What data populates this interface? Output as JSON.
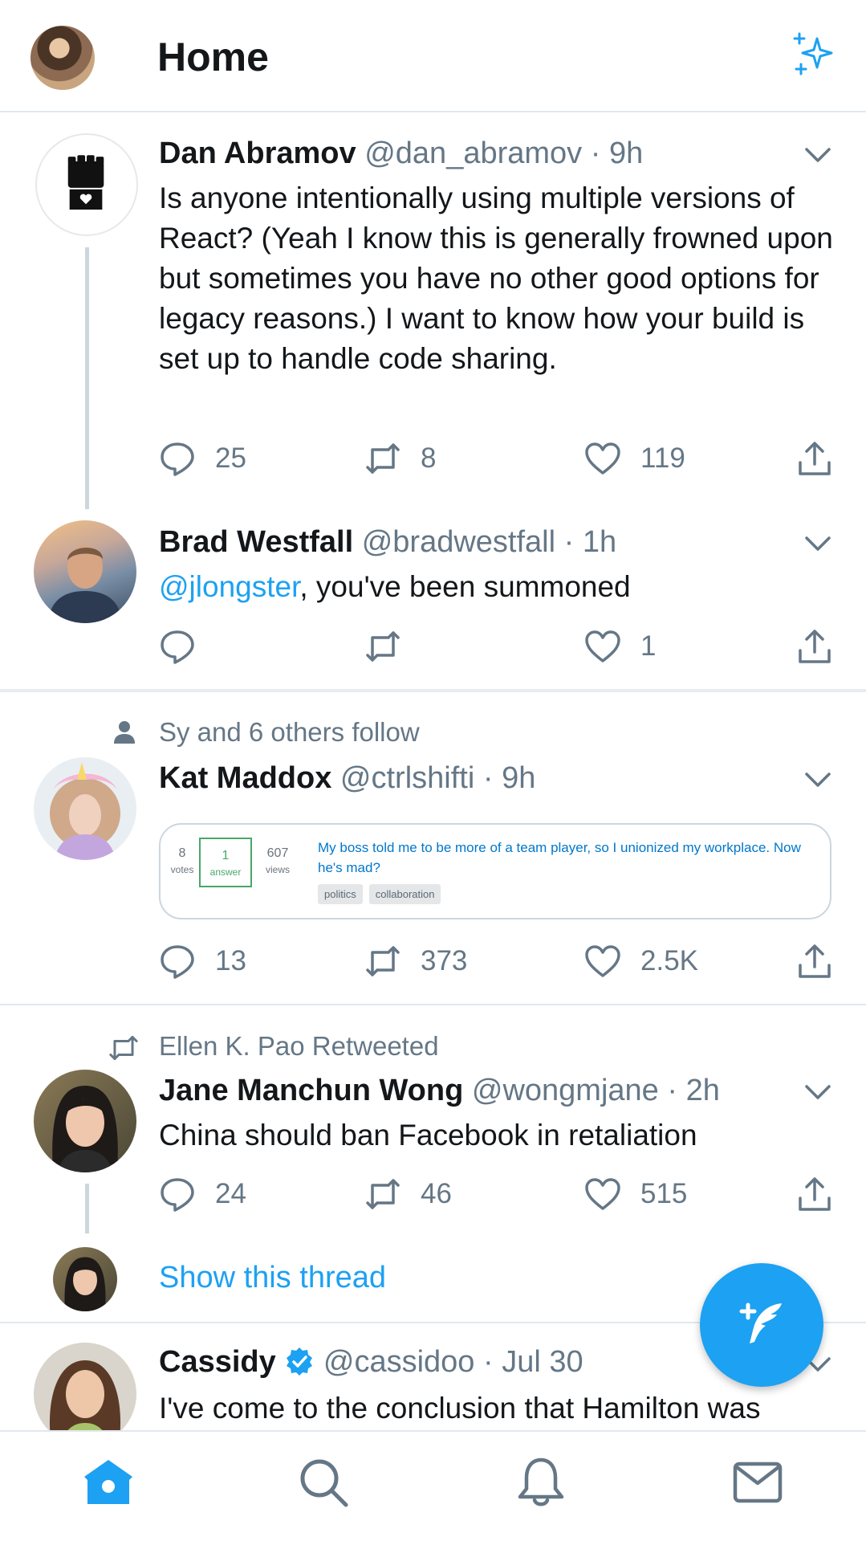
{
  "header": {
    "title": "Home",
    "sparkle_icon": "sparkle-icon",
    "accent": "#1da1f2"
  },
  "tweets": [
    {
      "name": "Dan Abramov",
      "handle": "@dan_abramov",
      "time": "9h",
      "text": "Is anyone intentionally using multiple versions of React? (Yeah I know this is generally frowned upon but sometimes you have no other good options for legacy reasons.) I want to know how your build is set up to handle code sharing.",
      "replies": "25",
      "retweets": "8",
      "likes": "119"
    },
    {
      "name": "Brad Westfall",
      "handle": "@bradwestfall",
      "time": "1h",
      "mention": "@jlongster",
      "text_rest": ", you've been summoned",
      "replies": "",
      "retweets": "",
      "likes": "1"
    },
    {
      "context": "Sy and 6 others follow",
      "name": "Kat Maddox",
      "handle": "@ctrlshifti",
      "time": "9h",
      "card": {
        "votes": "8",
        "votes_label": "votes",
        "answers": "1",
        "answers_label": "answer",
        "views": "607",
        "views_label": "views",
        "question": "My boss told me to be more of a team player, so I unionized my workplace. Now he's mad?",
        "tags": [
          "politics",
          "collaboration"
        ]
      },
      "replies": "13",
      "retweets": "373",
      "likes": "2.5K"
    },
    {
      "context": "Ellen K. Pao Retweeted",
      "name": "Jane Manchun Wong",
      "handle": "@wongmjane",
      "time": "2h",
      "text": "China should ban Facebook in retaliation",
      "replies": "24",
      "retweets": "46",
      "likes": "515"
    },
    {
      "name": "Cassidy",
      "handle": "@cassidoo",
      "time": "Jul 30",
      "text": "I've come to the conclusion that Hamilton was"
    }
  ],
  "show_thread": "Show this thread",
  "separator": "·",
  "nav": [
    "home-icon",
    "search-icon",
    "bell-icon",
    "mail-icon"
  ]
}
